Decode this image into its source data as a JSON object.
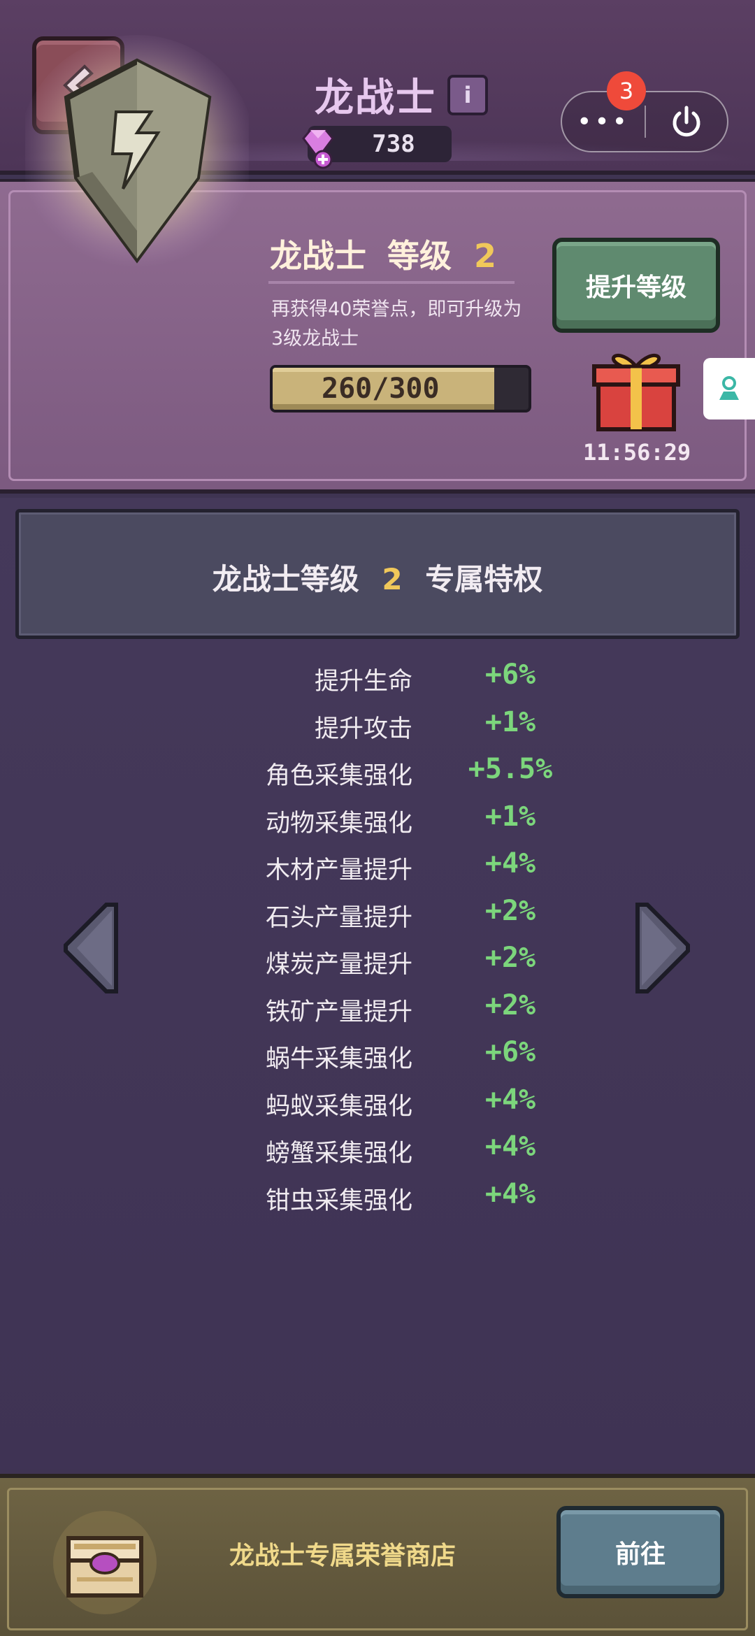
{
  "header": {
    "title": "龙战士",
    "gem_count": "738",
    "notification_count": "3"
  },
  "level": {
    "name": "龙战士",
    "level_label": "等级",
    "level_value": "2",
    "description": "再获得40荣誉点，即可升级为3级龙战士",
    "progress_text": "260/300",
    "progress_current": 260,
    "progress_max": 300,
    "upgrade_button": "提升等级",
    "timer": "11:56:29"
  },
  "privileges": {
    "title_prefix": "龙战士等级",
    "title_level": "2",
    "title_suffix": "专属特权",
    "rows": [
      {
        "label": "提升生命",
        "value": "+6%"
      },
      {
        "label": "提升攻击",
        "value": "+1%"
      },
      {
        "label": "角色采集强化",
        "value": "+5.5%"
      },
      {
        "label": "动物采集强化",
        "value": "+1%"
      },
      {
        "label": "木材产量提升",
        "value": "+4%"
      },
      {
        "label": "石头产量提升",
        "value": "+2%"
      },
      {
        "label": "煤炭产量提升",
        "value": "+2%"
      },
      {
        "label": "铁矿产量提升",
        "value": "+2%"
      },
      {
        "label": "蜗牛采集强化",
        "value": "+6%"
      },
      {
        "label": "蚂蚁采集强化",
        "value": "+4%"
      },
      {
        "label": "螃蟹采集强化",
        "value": "+4%"
      },
      {
        "label": "钳虫采集强化",
        "value": "+4%"
      }
    ]
  },
  "shop": {
    "label": "龙战士专属荣誉商店",
    "go_button": "前往"
  },
  "colors": {
    "accent_gold": "#f0c85a",
    "value_green": "#7cd67c",
    "badge_red": "#ef4a3a"
  },
  "icons": [
    "back-arrow-icon",
    "info-icon",
    "gem-icon",
    "more-icon",
    "power-icon",
    "shield-emblem-icon",
    "gift-icon",
    "side-tab-icon",
    "chevron-left-icon",
    "chevron-right-icon",
    "chest-icon"
  ]
}
